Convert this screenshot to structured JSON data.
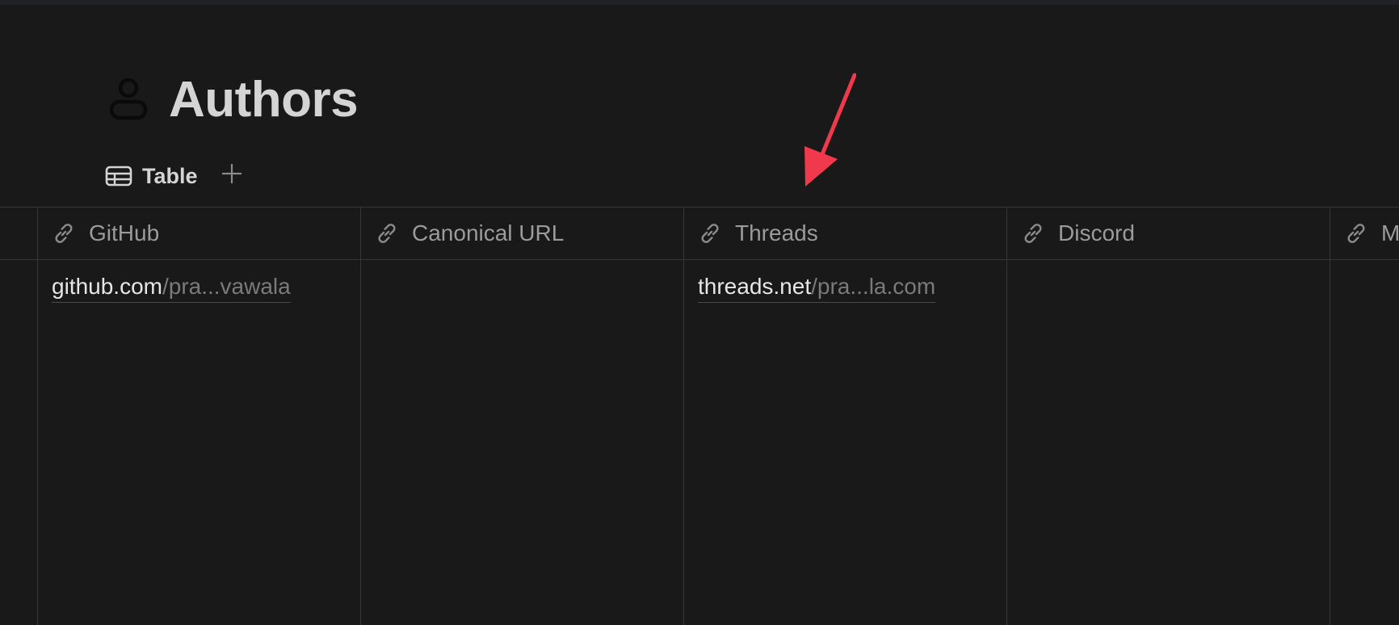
{
  "page": {
    "title": "Authors",
    "icon": "person-icon"
  },
  "views": {
    "tabs": [
      {
        "label": "Table",
        "icon": "table-icon"
      }
    ],
    "add_icon": "plus-icon"
  },
  "table": {
    "columns": [
      {
        "label": "GitHub",
        "icon": "link-icon"
      },
      {
        "label": "Canonical URL",
        "icon": "link-icon"
      },
      {
        "label": "Threads",
        "icon": "link-icon"
      },
      {
        "label": "Discord",
        "icon": "link-icon"
      },
      {
        "label": "M",
        "icon": "link-icon"
      }
    ],
    "rows": [
      {
        "github": {
          "domain": "github.com",
          "path": "/pra...vawala"
        },
        "canonical_url": "",
        "threads": {
          "domain": "threads.net",
          "path": "/pra...la.com"
        },
        "discord": ""
      }
    ]
  },
  "colors": {
    "background": "#191919",
    "annotation_arrow": "#f0394c"
  }
}
